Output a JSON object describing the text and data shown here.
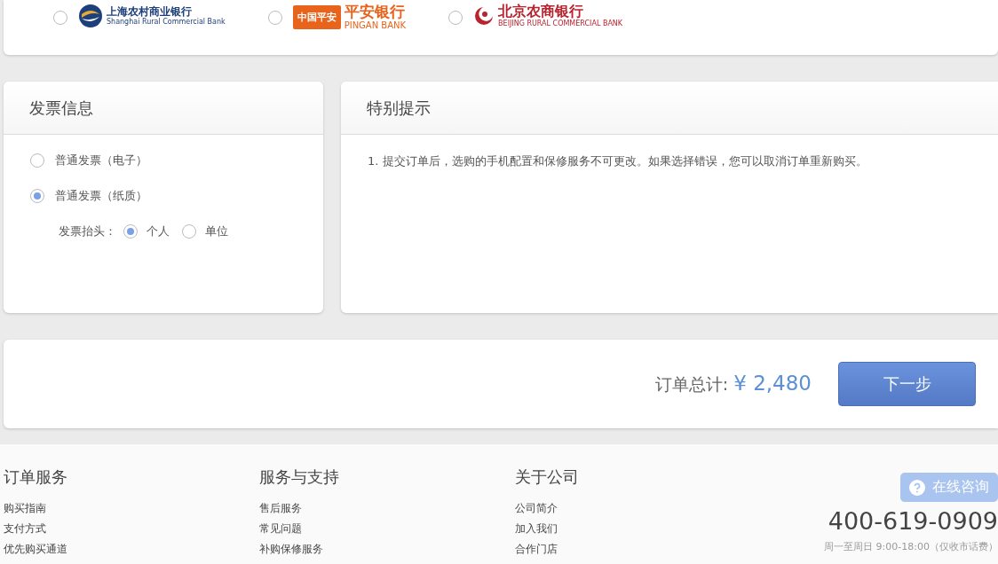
{
  "banks": [
    {
      "kind": "srcb",
      "selected": false,
      "name": "上海农村商业银行",
      "subtitle": "Shanghai Rural Commercial Bank"
    },
    {
      "kind": "pingan",
      "selected": false,
      "badge": "中国平安",
      "name": "平安银行",
      "subtitle": "PINGAN BANK"
    },
    {
      "kind": "bjrcb",
      "selected": false,
      "name": "北京农商银行",
      "subtitle": "BEIJING RURAL COMMERCIAL BANK"
    }
  ],
  "invoice": {
    "title": "发票信息",
    "options": [
      {
        "label": "普通发票（电子）",
        "selected": false
      },
      {
        "label": "普通发票（纸质）",
        "selected": true
      }
    ],
    "header_label": "发票抬头：",
    "header_options": [
      {
        "label": "个人",
        "selected": true
      },
      {
        "label": "单位",
        "selected": false
      }
    ]
  },
  "notice": {
    "title": "特别提示",
    "lines": [
      "1. 提交订单后，选购的手机配置和保修服务不可更改。如果选择错误，您可以取消订单重新购买。"
    ]
  },
  "order": {
    "total_label": "订单总计:",
    "total": "¥ 2,480",
    "next_button": "下一步"
  },
  "footer": {
    "columns": [
      {
        "title": "订单服务",
        "links": [
          "购买指南",
          "支付方式",
          "优先购买通道"
        ]
      },
      {
        "title": "服务与支持",
        "links": [
          "售后服务",
          "常见问题",
          "补购保修服务"
        ]
      },
      {
        "title": "关于公司",
        "links": [
          "公司简介",
          "加入我们",
          "合作门店"
        ]
      }
    ],
    "consult_button": "在线咨询",
    "phone": "400-619-0909",
    "hours": "周一至周日 9:00-18:00（仅收市话费）"
  }
}
